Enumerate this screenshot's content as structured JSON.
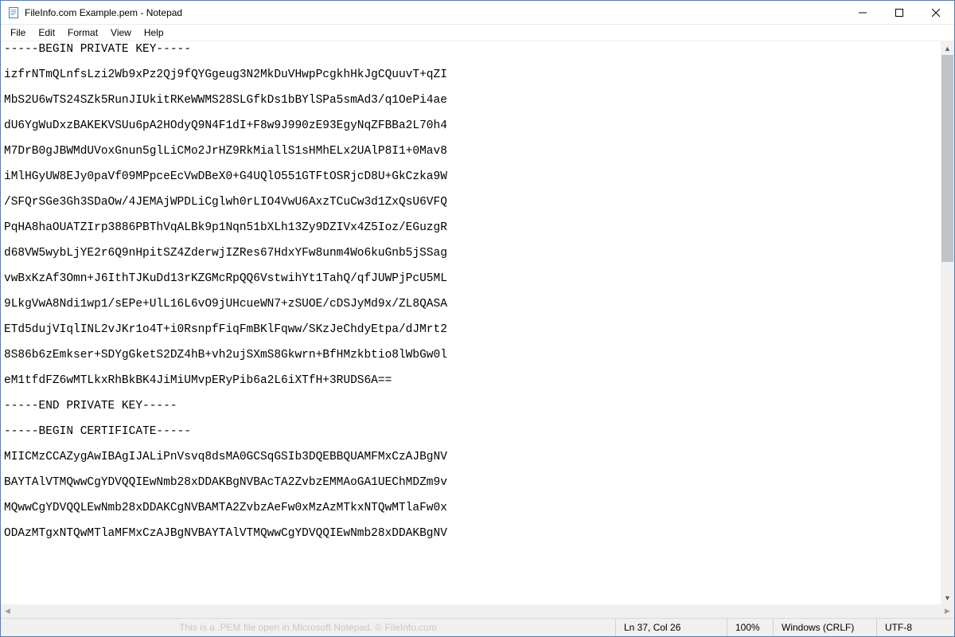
{
  "titlebar": {
    "title": "FileInfo.com Example.pem - Notepad"
  },
  "menu": {
    "file": "File",
    "edit": "Edit",
    "format": "Format",
    "view": "View",
    "help": "Help"
  },
  "content": "-----BEGIN PRIVATE KEY-----\n\nizfrNTmQLnfsLzi2Wb9xPz2Qj9fQYGgeug3N2MkDuVHwpPcgkhHkJgCQuuvT+qZI\n\nMbS2U6wTS24SZk5RunJIUkitRKeWWMS28SLGfkDs1bBYlSPa5smAd3/q1OePi4ae\n\ndU6YgWuDxzBAKEKVSUu6pA2HOdyQ9N4F1dI+F8w9J990zE93EgyNqZFBBa2L70h4\n\nM7DrB0gJBWMdUVoxGnun5glLiCMo2JrHZ9RkMiallS1sHMhELx2UAlP8I1+0Mav8\n\niMlHGyUW8EJy0paVf09MPpceEcVwDBeX0+G4UQlO551GTFtOSRjcD8U+GkCzka9W\n\n/SFQrSGe3Gh3SDaOw/4JEMAjWPDLiCglwh0rLIO4VwU6AxzTCuCw3d1ZxQsU6VFQ\n\nPqHA8haOUATZIrp3886PBThVqALBk9p1Nqn51bXLh13Zy9DZIVx4Z5Ioz/EGuzgR\n\nd68VW5wybLjYE2r6Q9nHpitSZ4ZderwjIZRes67HdxYFw8unm4Wo6kuGnb5jSSag\n\nvwBxKzAf3Omn+J6IthTJKuDd13rKZGMcRpQQ6VstwihYt1TahQ/qfJUWPjPcU5ML\n\n9LkgVwA8Ndi1wp1/sEPe+UlL16L6vO9jUHcueWN7+zSUOE/cDSJyMd9x/ZL8QASA\n\nETd5dujVIqlINL2vJKr1o4T+i0RsnpfFiqFmBKlFqww/SKzJeChdyEtpa/dJMrt2\n\n8S86b6zEmkser+SDYgGketS2DZ4hB+vh2ujSXmS8Gkwrn+BfHMzkbtio8lWbGw0l\n\neM1tfdFZ6wMTLkxRhBkBK4JiMiUMvpERyPib6a2L6iXTfH+3RUDS6A==\n\n-----END PRIVATE KEY-----\n\n-----BEGIN CERTIFICATE-----\n\nMIICMzCCAZygAwIBAgIJALiPnVsvq8dsMA0GCSqGSIb3DQEBBQUAMFMxCzAJBgNV\n\nBAYTAlVTMQwwCgYDVQQIEwNmb28xDDAKBgNVBAcTA2ZvbzEMMAoGA1UEChMDZm9v\n\nMQwwCgYDVQQLEwNmb28xDDAKCgNVBAMTA2ZvbzAeFw0xMzAzMTkxNTQwMTlaFw0x\n\nODAzMTgxNTQwMTlaMFMxCzAJBgNVBAYTAlVTMQwwCgYDVQQIEwNmb28xDDAKBgNV",
  "status": {
    "caption": "This is a .PEM file open in Microsoft Notepad. © FileInfo.com",
    "lncol": "Ln 37, Col 26",
    "zoom": "100%",
    "ending": "Windows (CRLF)",
    "encoding": "UTF-8"
  }
}
